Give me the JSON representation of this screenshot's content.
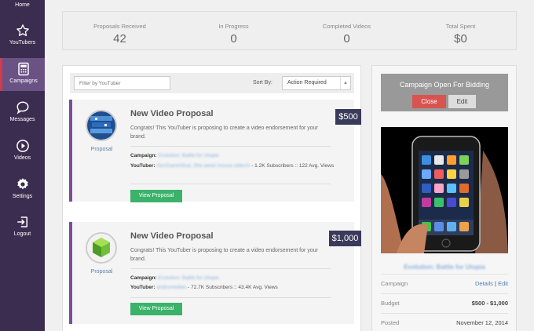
{
  "sidebar": {
    "items": [
      {
        "label": "Home",
        "icon": "home-icon"
      },
      {
        "label": "YouTubers",
        "icon": "star-icon"
      },
      {
        "label": "Campaigns",
        "icon": "calculator-icon",
        "active": true
      },
      {
        "label": "Messages",
        "icon": "chat-bubble-icon"
      },
      {
        "label": "Videos",
        "icon": "play-circle-icon"
      },
      {
        "label": "Settings",
        "icon": "gear-icon"
      },
      {
        "label": "Logout",
        "icon": "logout-icon"
      }
    ]
  },
  "stats": [
    {
      "label": "Proposals Received",
      "value": "42"
    },
    {
      "label": "In Progress",
      "value": "0"
    },
    {
      "label": "Completed Videos",
      "value": "0"
    },
    {
      "label": "Total Spent",
      "value": "$0"
    }
  ],
  "filter": {
    "placeholder": "Filter by YouTuber",
    "sort_label": "Sort By:",
    "sort_value": "Action Required"
  },
  "proposals": [
    {
      "avatar_label": "Proposal",
      "title": "New Video Proposal",
      "description": "Congrats! This YouTuber is proposing to create a video endorsement for your brand.",
      "campaign_label": "Campaign:",
      "campaign_name": "Evolution: Battle for Utopia",
      "youtuber_label": "YouTuber:",
      "youtuber_name": "GenGameStud, She week mouse video'ir",
      "youtuber_stats": " - 1.2K Subscribers :: 122 Avg. Views",
      "button": "View Proposal",
      "price": "$500"
    },
    {
      "avatar_label": "Proposal",
      "title": "New Video Proposal",
      "description": "Congrats! This YouTuber is proposing to create a video endorsement for your brand.",
      "campaign_label": "Campaign:",
      "campaign_name": "Evolution: Battle for Utopia",
      "youtuber_label": "YouTuber:",
      "youtuber_name": "andromedian",
      "youtuber_stats": " - 72.7K Subscribers :: 43.4K Avg. Views",
      "button": "View Proposal",
      "price": "$1,000"
    }
  ],
  "campaign_panel": {
    "title": "Campaign Open For Bidding",
    "close_label": "Close",
    "edit_label": "Edit",
    "name": "Evolution: Battle for Utopia",
    "rows": [
      {
        "key": "Campaign",
        "link1": "Details",
        "sep": " | ",
        "link2": "Edit"
      },
      {
        "key": "Budget",
        "value": "$500 - $1,000"
      },
      {
        "key": "Posted",
        "value": "November 12, 2014"
      }
    ]
  },
  "colors": {
    "sidebar_bg": "#3b2d4f",
    "accent_purple": "#7a4e9a",
    "button_green": "#3bb26a",
    "close_red": "#d9534f",
    "price_tag": "#3a3a5a"
  }
}
